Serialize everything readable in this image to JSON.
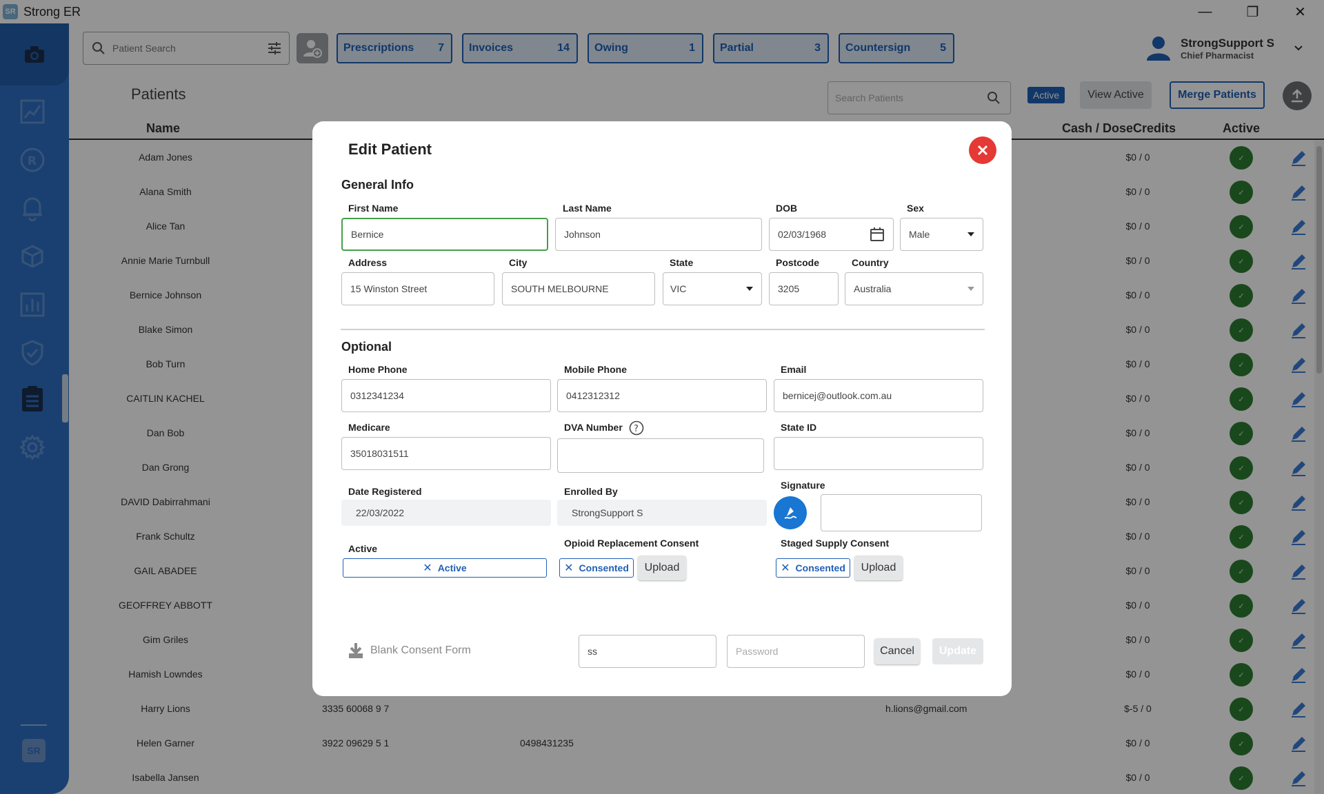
{
  "window": {
    "title": "Strong ER",
    "logo_text": "SR",
    "minimize": "—",
    "restore": "❐",
    "close": "✕"
  },
  "sidebar": {
    "top_icon": "camera-icon",
    "items": [
      "chart-line-icon",
      "rx-icon",
      "bell-icon",
      "box-icon",
      "bar-chart-icon",
      "shield-check-icon",
      "clipboard-icon",
      "gear-icon"
    ],
    "bottom_logo": "SR"
  },
  "topbar": {
    "search_placeholder": "Patient Search",
    "queues": [
      {
        "label": "Prescriptions",
        "count": "7"
      },
      {
        "label": "Invoices",
        "count": "14"
      },
      {
        "label": "Owing",
        "count": "1"
      },
      {
        "label": "Partial",
        "count": "3"
      },
      {
        "label": "Countersign",
        "count": "5"
      }
    ],
    "user_name": "StrongSupport S",
    "user_role": "Chief Pharmacist"
  },
  "patients": {
    "title": "Patients",
    "search_placeholder": "Search Patients",
    "filter_badge": "Active",
    "view_active_label": "View Active",
    "merge_label": "Merge Patients",
    "columns": {
      "name": "Name",
      "cash": "Cash / DoseCredits",
      "active": "Active"
    },
    "rows": [
      {
        "name": "Adam Jones",
        "c2": "",
        "c3": "",
        "c4": "",
        "cash": "$0 / 0"
      },
      {
        "name": "Alana Smith",
        "c2": "",
        "c3": "",
        "c4": "",
        "cash": "$0 / 0"
      },
      {
        "name": "Alice Tan",
        "c2": "",
        "c3": "",
        "c4": "",
        "cash": "$0 / 0"
      },
      {
        "name": "Annie Marie Turnbull",
        "c2": "",
        "c3": "",
        "c4": "",
        "cash": "$0 / 0"
      },
      {
        "name": "Bernice Johnson",
        "c2": "",
        "c3": "",
        "c4": "",
        "cash": "$0 / 0"
      },
      {
        "name": "Blake Simon",
        "c2": "",
        "c3": "",
        "c4": "",
        "cash": "$0 / 0"
      },
      {
        "name": "Bob Turn",
        "c2": "",
        "c3": "",
        "c4": "",
        "cash": "$0 / 0"
      },
      {
        "name": "CAITLIN KACHEL",
        "c2": "",
        "c3": "",
        "c4": "",
        "cash": "$0 / 0"
      },
      {
        "name": "Dan Bob",
        "c2": "",
        "c3": "",
        "c4": "",
        "cash": "$0 / 0"
      },
      {
        "name": "Dan Grong",
        "c2": "",
        "c3": "",
        "c4": "",
        "cash": "$0 / 0"
      },
      {
        "name": "DAVID Dabirrahmani",
        "c2": "",
        "c3": "",
        "c4": "",
        "cash": "$0 / 0"
      },
      {
        "name": "Frank Schultz",
        "c2": "",
        "c3": "",
        "c4": "",
        "cash": "$0 / 0"
      },
      {
        "name": "GAIL ABADEE",
        "c2": "",
        "c3": "",
        "c4": "",
        "cash": "$0 / 0"
      },
      {
        "name": "GEOFFREY ABBOTT",
        "c2": "",
        "c3": "",
        "c4": "",
        "cash": "$0 / 0"
      },
      {
        "name": "Gim Griles",
        "c2": "",
        "c3": "",
        "c4": "",
        "cash": "$0 / 0"
      },
      {
        "name": "Hamish Lowndes",
        "c2": "",
        "c3": "",
        "c4": "",
        "cash": "$0 / 0"
      },
      {
        "name": "Harry Lions",
        "c2": "3335 60068 9 7",
        "c3": "",
        "c4": "h.lions@gmail.com",
        "cash": "$-5 / 0"
      },
      {
        "name": "Helen Garner",
        "c2": "3922 09629 5 1",
        "c3": "0498431235",
        "c4": "",
        "cash": "$0 / 0"
      },
      {
        "name": "Isabella Jansen",
        "c2": "",
        "c3": "",
        "c4": "",
        "cash": "$0 / 0"
      }
    ],
    "active_check": "✓"
  },
  "modal": {
    "title": "Edit Patient",
    "general_title": "General Info",
    "first_name": {
      "label": "First Name",
      "value": "Bernice"
    },
    "last_name": {
      "label": "Last Name",
      "value": "Johnson"
    },
    "dob": {
      "label": "DOB",
      "value": "02/03/1968"
    },
    "sex": {
      "label": "Sex",
      "value": "Male"
    },
    "address": {
      "label": "Address",
      "value": "15 Winston Street"
    },
    "city": {
      "label": "City",
      "value": "SOUTH MELBOURNE"
    },
    "state": {
      "label": "State",
      "value": "VIC"
    },
    "postcode": {
      "label": "Postcode",
      "value": "3205"
    },
    "country": {
      "label": "Country",
      "value": "Australia"
    },
    "optional_title": "Optional",
    "home_phone": {
      "label": "Home Phone",
      "value": "0312341234"
    },
    "mobile_phone": {
      "label": "Mobile Phone",
      "value": "0412312312"
    },
    "email": {
      "label": "Email",
      "value": "bernicej@outlook.com.au"
    },
    "medicare": {
      "label": "Medicare",
      "value": "35018031511"
    },
    "dva": {
      "label": "DVA Number",
      "value": ""
    },
    "state_id": {
      "label": "State ID",
      "value": ""
    },
    "date_registered": {
      "label": "Date Registered",
      "value": "22/03/2022"
    },
    "enrolled_by": {
      "label": "Enrolled By",
      "value": "StrongSupport S"
    },
    "signature": {
      "label": "Signature"
    },
    "active": {
      "label": "Active",
      "chip": "Active"
    },
    "opioid": {
      "label": "Opioid Replacement Consent",
      "chip": "Consented",
      "upload": "Upload"
    },
    "staged": {
      "label": "Staged Supply Consent",
      "chip": "Consented",
      "upload": "Upload"
    },
    "blank_consent": "Blank Consent Form",
    "auth_user": "ss",
    "password_placeholder": "Password",
    "cancel": "Cancel",
    "update": "Update"
  }
}
